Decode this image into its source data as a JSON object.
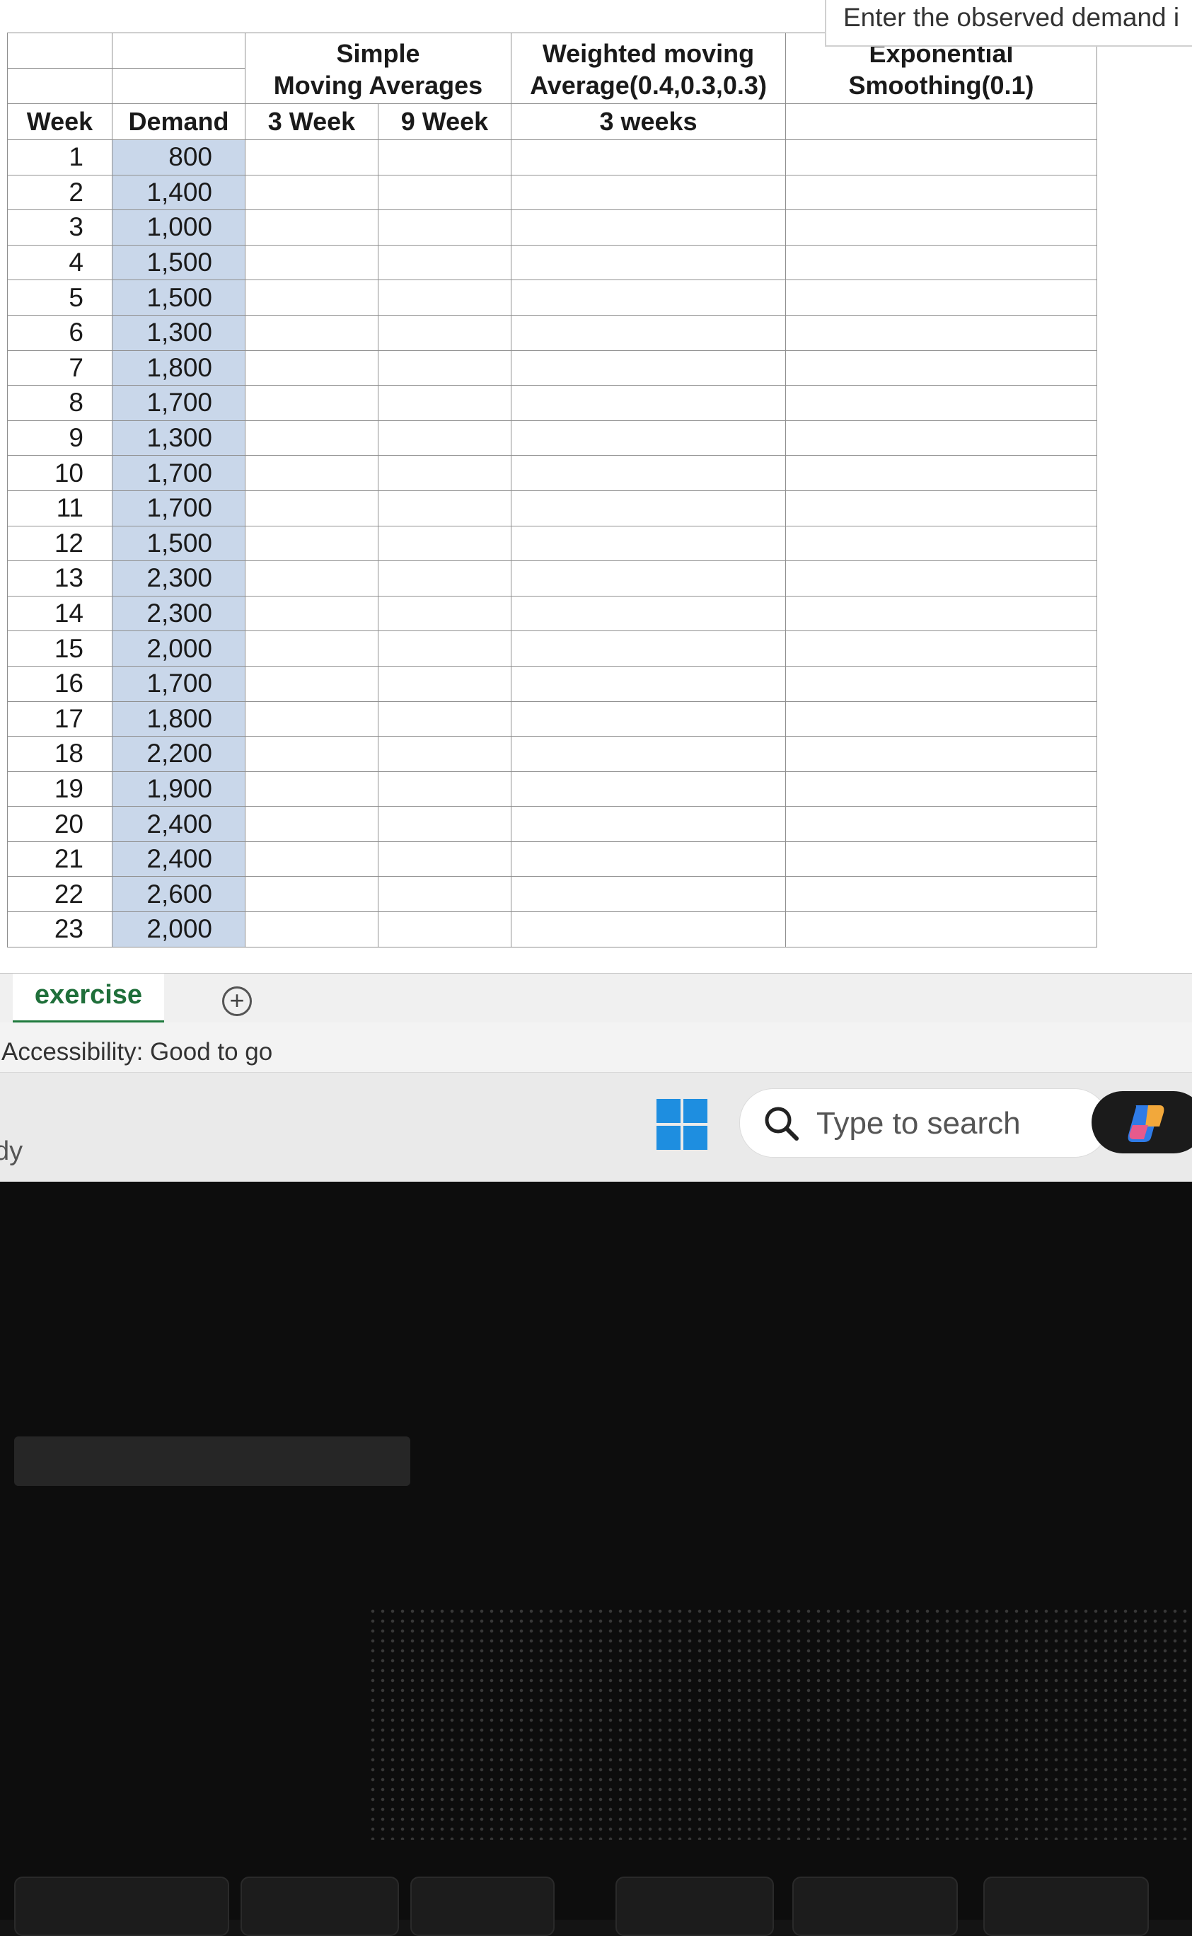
{
  "tooltip": "Enter the observed demand i",
  "headers": {
    "simple_top": "Simple",
    "simple_bottom": "Moving Averages",
    "weighted_top": "Weighted moving",
    "weighted_bottom": "Average(0.4,0.3,0.3)",
    "exp_top": "Exponential",
    "exp_bottom": "Smoothing(0.1)",
    "week": "Week",
    "demand": "Demand",
    "sma3": "3 Week",
    "sma9": "9 Week",
    "wma": "3 weeks"
  },
  "rows": [
    {
      "week": "1",
      "demand": "800"
    },
    {
      "week": "2",
      "demand": "1,400"
    },
    {
      "week": "3",
      "demand": "1,000"
    },
    {
      "week": "4",
      "demand": "1,500"
    },
    {
      "week": "5",
      "demand": "1,500"
    },
    {
      "week": "6",
      "demand": "1,300"
    },
    {
      "week": "7",
      "demand": "1,800"
    },
    {
      "week": "8",
      "demand": "1,700"
    },
    {
      "week": "9",
      "demand": "1,300"
    },
    {
      "week": "10",
      "demand": "1,700"
    },
    {
      "week": "11",
      "demand": "1,700"
    },
    {
      "week": "12",
      "demand": "1,500"
    },
    {
      "week": "13",
      "demand": "2,300"
    },
    {
      "week": "14",
      "demand": "2,300"
    },
    {
      "week": "15",
      "demand": "2,000"
    },
    {
      "week": "16",
      "demand": "1,700"
    },
    {
      "week": "17",
      "demand": "1,800"
    },
    {
      "week": "18",
      "demand": "2,200"
    },
    {
      "week": "19",
      "demand": "1,900"
    },
    {
      "week": "20",
      "demand": "2,400"
    },
    {
      "week": "21",
      "demand": "2,400"
    },
    {
      "week": "22",
      "demand": "2,600"
    },
    {
      "week": "23",
      "demand": "2,000"
    }
  ],
  "sheet_tab": "exercise",
  "add_sheet_glyph": "+",
  "status": "Accessibility: Good to go",
  "taskbar": {
    "ready_partial": "dy",
    "search_placeholder": "Type to search"
  },
  "icons": {
    "start": "windows-start-icon",
    "search": "search-icon",
    "copilot": "copilot-icon",
    "add": "plus-circle-icon"
  }
}
